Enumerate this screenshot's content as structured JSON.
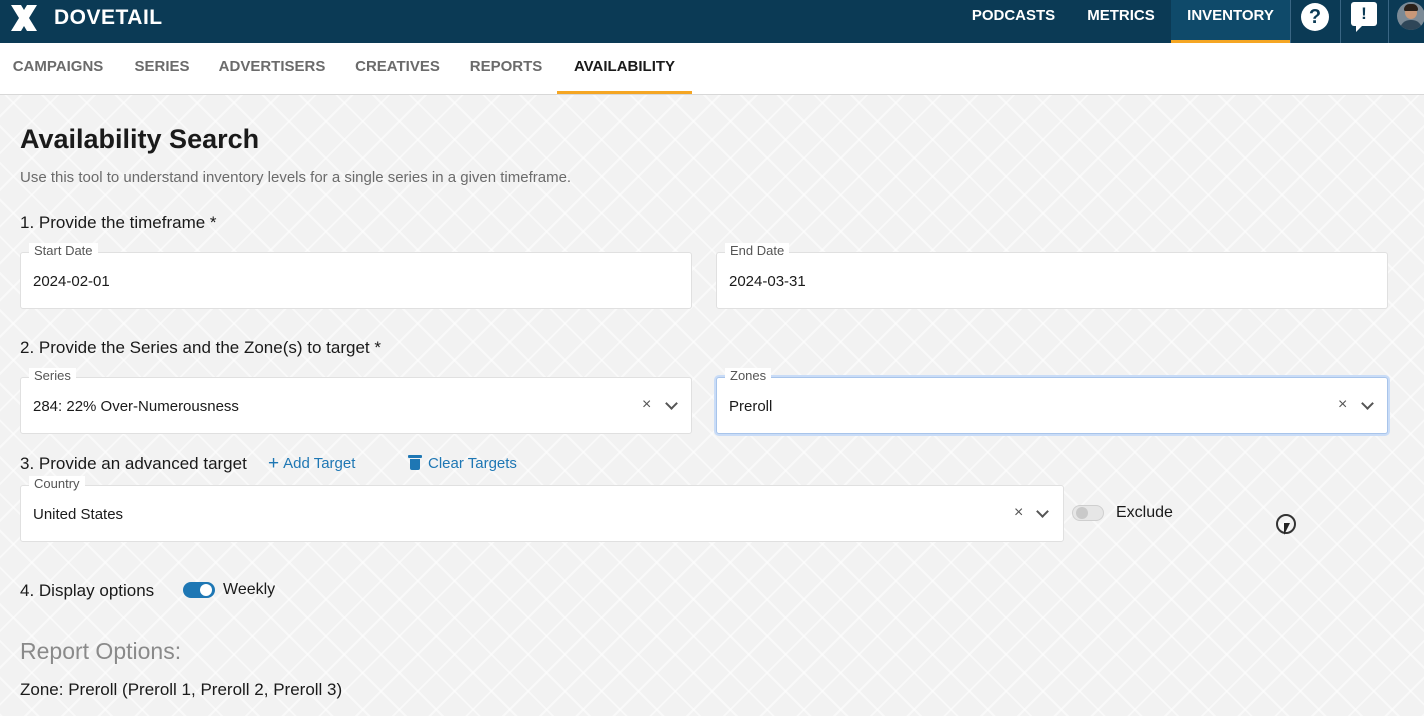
{
  "app": {
    "brand": "DOVETAIL"
  },
  "topnav": {
    "items": [
      {
        "label": "PODCASTS"
      },
      {
        "label": "METRICS"
      },
      {
        "label": "INVENTORY"
      }
    ],
    "help_glyph": "?",
    "feedback_glyph": "!"
  },
  "subnav": {
    "items": [
      {
        "label": "CAMPAIGNS"
      },
      {
        "label": "SERIES"
      },
      {
        "label": "ADVERTISERS"
      },
      {
        "label": "CREATIVES"
      },
      {
        "label": "REPORTS"
      },
      {
        "label": "AVAILABILITY"
      }
    ],
    "active": "AVAILABILITY"
  },
  "page": {
    "title": "Availability Search",
    "description": "Use this tool to understand inventory levels for a single series in a given timeframe."
  },
  "step1": {
    "heading": "1. Provide the timeframe *",
    "start_date": {
      "label": "Start Date",
      "value": "2024-02-01"
    },
    "end_date": {
      "label": "End Date",
      "value": "2024-03-31"
    }
  },
  "step2": {
    "heading": "2. Provide the Series and the Zone(s) to target *",
    "series": {
      "label": "Series",
      "value": "284: 22% Over-Numerousness"
    },
    "zones": {
      "label": "Zones",
      "value": "Preroll"
    }
  },
  "step3": {
    "heading": "3. Provide an advanced target",
    "add_target": "Add Target",
    "clear_targets": "Clear Targets",
    "country": {
      "label": "Country",
      "value": "United States"
    },
    "exclude": {
      "label": "Exclude",
      "on": false
    }
  },
  "step4": {
    "heading": "4. Display options",
    "weekly": {
      "label": "Weekly",
      "on": true
    }
  },
  "report": {
    "heading": "Report Options:",
    "zone_line": "Zone: Preroll (Preroll 1, Preroll 2, Preroll 3)"
  },
  "glyphs": {
    "clear": "×",
    "plus": "+"
  },
  "colors": {
    "topbar": "#0b3a55",
    "accent": "#f5a623",
    "link": "#1e77b4"
  },
  "icons": {
    "logo": "dovetail-x-logo",
    "help": "help-icon",
    "feedback": "feedback-icon",
    "add": "plus-icon",
    "clear": "trash-icon"
  }
}
